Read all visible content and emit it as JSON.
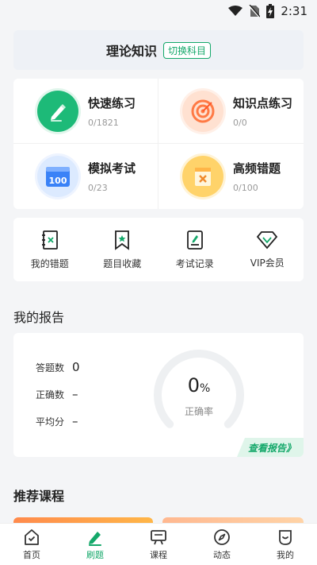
{
  "status_bar": {
    "time": "2:31"
  },
  "subject": {
    "title": "理论知识",
    "switch_label": "切换科目"
  },
  "practice": [
    {
      "title": "快速练习",
      "count": "0/1821",
      "icon": "pencil-icon"
    },
    {
      "title": "知识点练习",
      "count": "0/0",
      "icon": "target-icon"
    },
    {
      "title": "模拟考试",
      "count": "0/23",
      "icon": "calendar-100-icon"
    },
    {
      "title": "高频错题",
      "count": "0/100",
      "icon": "folder-x-icon"
    }
  ],
  "tools": [
    {
      "label": "我的错题",
      "icon": "wrong-book-icon"
    },
    {
      "label": "题目收藏",
      "icon": "bookmark-icon"
    },
    {
      "label": "考试记录",
      "icon": "exam-record-icon"
    },
    {
      "label": "VIP会员",
      "icon": "diamond-icon"
    }
  ],
  "report": {
    "heading": "我的报告",
    "answered_label": "答题数",
    "answered_value": "0",
    "correct_label": "正确数",
    "correct_value": "–",
    "average_label": "平均分",
    "average_value": "–",
    "rate_value": "0",
    "rate_unit": "%",
    "rate_label": "正确率",
    "rate_fraction": 0,
    "view_label": "查看报告》"
  },
  "courses": {
    "heading": "推荐课程"
  },
  "tabs": [
    {
      "label": "首页",
      "icon": "home-icon",
      "active": false
    },
    {
      "label": "刷题",
      "icon": "pencil-icon",
      "active": true
    },
    {
      "label": "课程",
      "icon": "course-board-icon",
      "active": false
    },
    {
      "label": "动态",
      "icon": "compass-icon",
      "active": false
    },
    {
      "label": "我的",
      "icon": "profile-icon",
      "active": false
    }
  ],
  "colors": {
    "accent": "#14a86a",
    "background": "#f4f5f7"
  }
}
